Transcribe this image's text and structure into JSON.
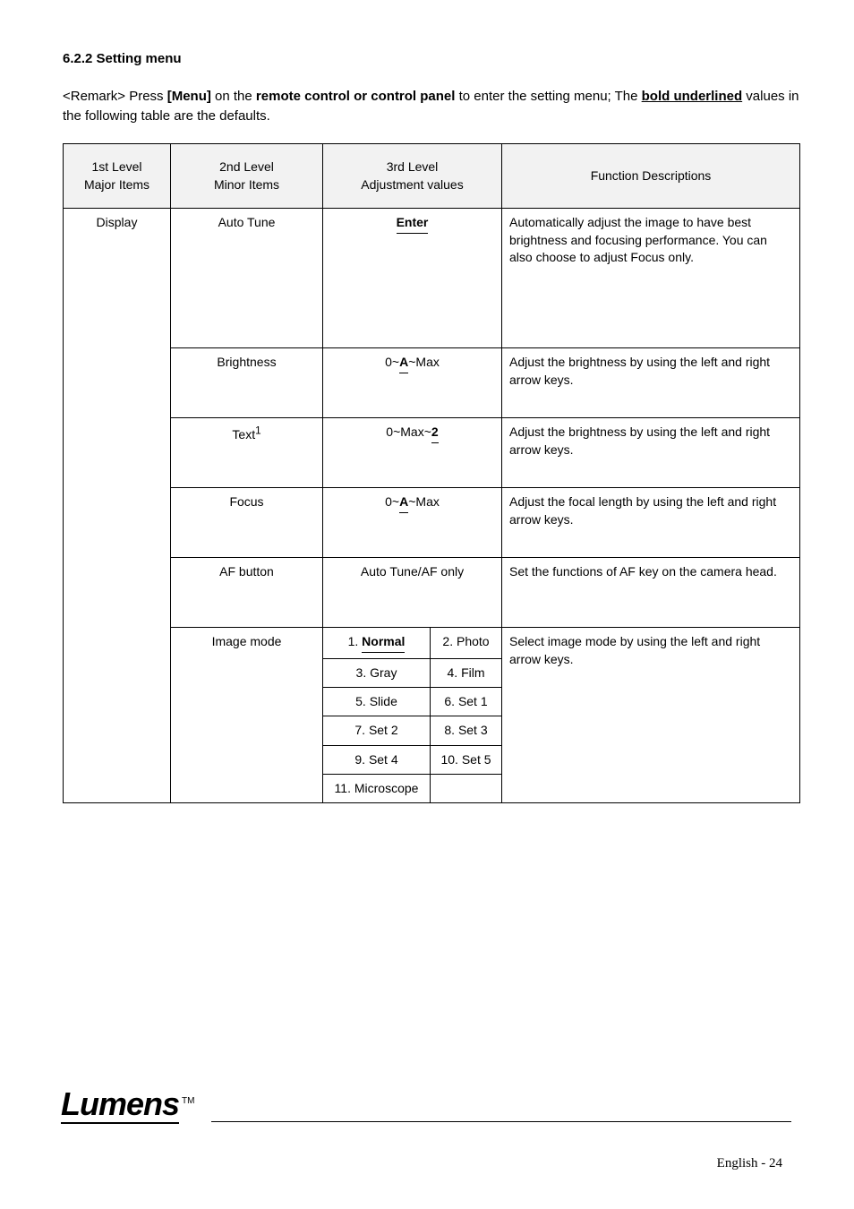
{
  "intro": {
    "line1": "6.2.2 Setting menu",
    "line2_pre": "<Remark> Press ",
    "line2_bold": "[Menu]",
    "line2_mid": " on the ",
    "line2_bold2": "remote control or control panel",
    "line2_post": " to enter the setting menu; The ",
    "line3_part1": "bold underlined",
    "line3_part2": " values in the following table are the defaults."
  },
  "headers": {
    "h1": "1st Level\nMajor Items",
    "h2": "2nd Level\nMinor Items",
    "h3": "3rd Level\nAdjustment values",
    "h4": "Function Descriptions"
  },
  "rows": [
    {
      "lvl2": "Auto Tune",
      "lvl3": [
        [
          "Enter",
          true
        ]
      ],
      "desc": "Automatically adjust the image to have best brightness and focusing performance. You can also choose to adjust Focus only.",
      "lvl3_style": "single",
      "lvl3_height": 6
    },
    {
      "lvl2": "Brightness",
      "lvl3": [
        [
          "0~A~Max",
          false
        ]
      ],
      "desc": "Adjust the brightness by using the left and right arrow keys.",
      "lvl3_style": "single",
      "lvl3_height": 3,
      "extra_underline": "A"
    },
    {
      "lvl2": "Text¹",
      "lvl3": [
        [
          "0~Max~2",
          false
        ]
      ],
      "desc": "Adjust the brightness by using the left and right arrow keys.",
      "lvl3_style": "single",
      "lvl3_height": 3,
      "extra_underline": "2"
    },
    {
      "lvl2": "Focus",
      "lvl3": [
        [
          "0~A~Max",
          false
        ]
      ],
      "desc": "Adjust the focal length by using the left and right arrow keys.",
      "lvl3_style": "single",
      "lvl3_height": 3,
      "extra_underline": "A"
    },
    {
      "lvl2": "AF button",
      "lvl3": [
        [
          "Auto Tune/AF only",
          false
        ]
      ],
      "desc": "Set the functions of AF key on the camera head.",
      "lvl3_style": "single",
      "lvl3_height": 3
    },
    {
      "lvl2": "Image mode",
      "lvl3": [
        [
          "Normal",
          true
        ],
        [
          "Photo",
          false
        ],
        [
          "Gray",
          false
        ],
        [
          "Film",
          false
        ],
        [
          "Slide",
          false
        ],
        [
          "Set 1",
          false
        ],
        [
          "Set 2",
          false
        ],
        [
          "Set 3",
          false
        ],
        [
          "Set 4",
          false
        ],
        [
          "Set 5",
          false
        ],
        [
          "Microscope",
          false
        ]
      ],
      "desc": "Select image mode by using the left and right arrow keys.",
      "lvl3_style": "pairs"
    }
  ],
  "lvl1": "Display",
  "footer": {
    "logo": "Lumens",
    "tm": "TM",
    "page": "English - 24"
  }
}
